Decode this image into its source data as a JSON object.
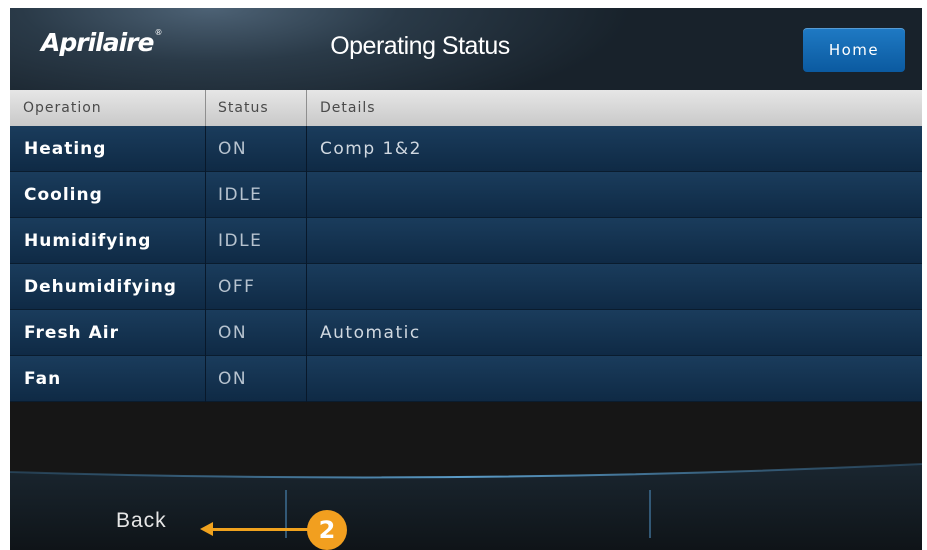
{
  "header": {
    "logo": "Aprilaire",
    "logo_mark": "®",
    "title": "Operating Status",
    "home_label": "Home"
  },
  "table": {
    "columns": [
      "Operation",
      "Status",
      "Details"
    ],
    "rows": [
      {
        "operation": "Heating",
        "status": "ON",
        "details": "Comp 1&2"
      },
      {
        "operation": "Cooling",
        "status": "IDLE",
        "details": ""
      },
      {
        "operation": "Humidifying",
        "status": "IDLE",
        "details": ""
      },
      {
        "operation": "Dehumidifying",
        "status": "OFF",
        "details": ""
      },
      {
        "operation": "Fresh Air",
        "status": "ON",
        "details": "Automatic"
      },
      {
        "operation": "Fan",
        "status": "ON",
        "details": ""
      }
    ]
  },
  "footer": {
    "back_label": "Back"
  },
  "annotation": {
    "callout_number": "2",
    "color": "#f29f1f"
  },
  "colors": {
    "header_bg": "#2a3a48",
    "row_bg": "#0f2a45",
    "home_button": "#1f7ac4",
    "table_header_bg": "#d8d8d8"
  }
}
